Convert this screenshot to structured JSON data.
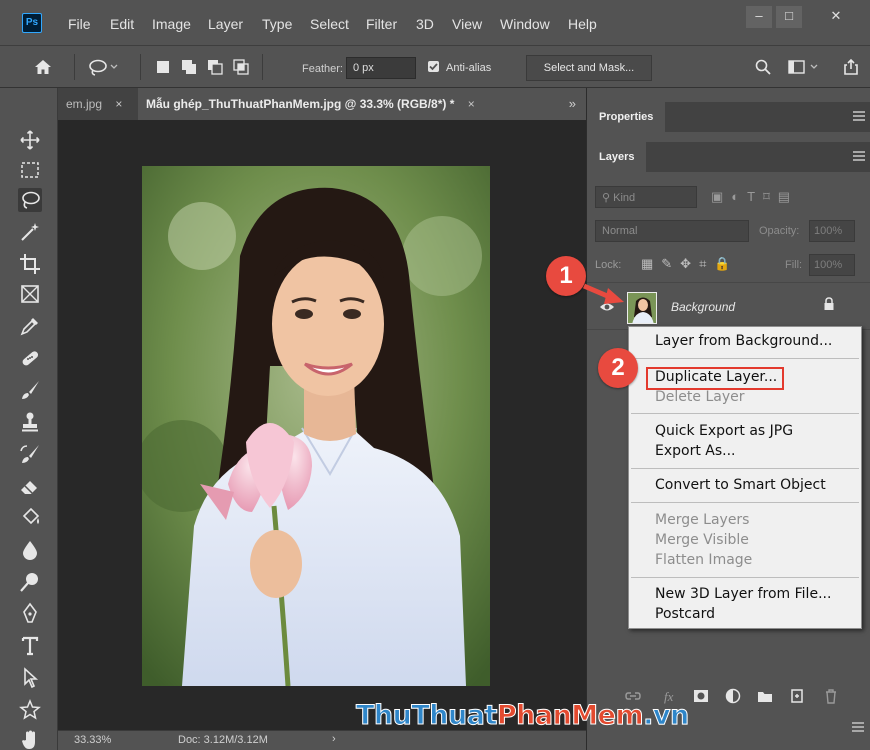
{
  "app": {
    "logo": "Ps",
    "menu": [
      "File",
      "Edit",
      "Image",
      "Layer",
      "Type",
      "Select",
      "Filter",
      "3D",
      "View",
      "Window",
      "Help"
    ],
    "window_controls": {
      "minimize": "–",
      "maximize": "□",
      "close": "✕"
    }
  },
  "options_bar": {
    "feather_label": "Feather:",
    "feather_value": "0 px",
    "anti_alias_label": "Anti-alias",
    "anti_alias_checked": true,
    "select_and_mask_label": "Select and Mask..."
  },
  "tabs": [
    {
      "label": "em.jpg",
      "close": "×",
      "active": false
    },
    {
      "label": "Mẫu ghép_ThuThuatPhanMem.jpg @ 33.3% (RGB/8*) *",
      "close": "×",
      "active": true
    }
  ],
  "tab_more": "»",
  "tools": [
    "move-tool",
    "marquee-tool",
    "lasso-tool",
    "magic-wand-tool",
    "crop-tool",
    "frame-tool",
    "eyedropper-tool",
    "healing-brush-tool",
    "brush-tool",
    "clone-stamp-tool",
    "history-brush-tool",
    "eraser-tool",
    "paint-bucket-tool",
    "blur-tool",
    "dodge-tool",
    "pen-tool",
    "type-tool",
    "path-selection-tool",
    "shape-tool",
    "hand-tool"
  ],
  "status": {
    "zoom": "33.33%",
    "doc": "Doc: 3.12M/3.12M",
    "arrow": "›"
  },
  "panels": {
    "properties_tab": "Properties",
    "layers_tab": "Layers",
    "kind_label": "Kind",
    "blend_mode": "Normal",
    "opacity_label": "Opacity:",
    "opacity_value": "100%",
    "lock_label": "Lock:",
    "fill_label": "Fill:",
    "fill_value": "100%",
    "layer": {
      "name": "Background",
      "visible": true,
      "locked": true
    }
  },
  "context_menu": {
    "items": [
      {
        "label": "Layer from Background...",
        "enabled": true
      },
      {
        "label": "Duplicate Layer...",
        "enabled": true,
        "highlighted": true
      },
      {
        "label": "Delete Layer",
        "enabled": false
      },
      {
        "label": "Quick Export as JPG",
        "enabled": true
      },
      {
        "label": "Export As...",
        "enabled": true
      },
      {
        "label": "Convert to Smart Object",
        "enabled": true
      },
      {
        "label": "Merge Layers",
        "enabled": false
      },
      {
        "label": "Merge Visible",
        "enabled": false
      },
      {
        "label": "Flatten Image",
        "enabled": false
      },
      {
        "label": "New 3D Layer from File...",
        "enabled": true
      },
      {
        "label": "Postcard",
        "enabled": true
      }
    ]
  },
  "steps": [
    "1",
    "2"
  ],
  "watermark": {
    "part1": "ThuThuat",
    "part2": "PhanMem",
    "part3": ".vn"
  },
  "colors": {
    "ui_background": "#535353",
    "canvas_background": "#282828",
    "accent_red": "#e84a3f",
    "ps_blue": "#31a8ff",
    "watermark_blue": "#2f86c9",
    "watermark_red": "#e34a2f"
  }
}
